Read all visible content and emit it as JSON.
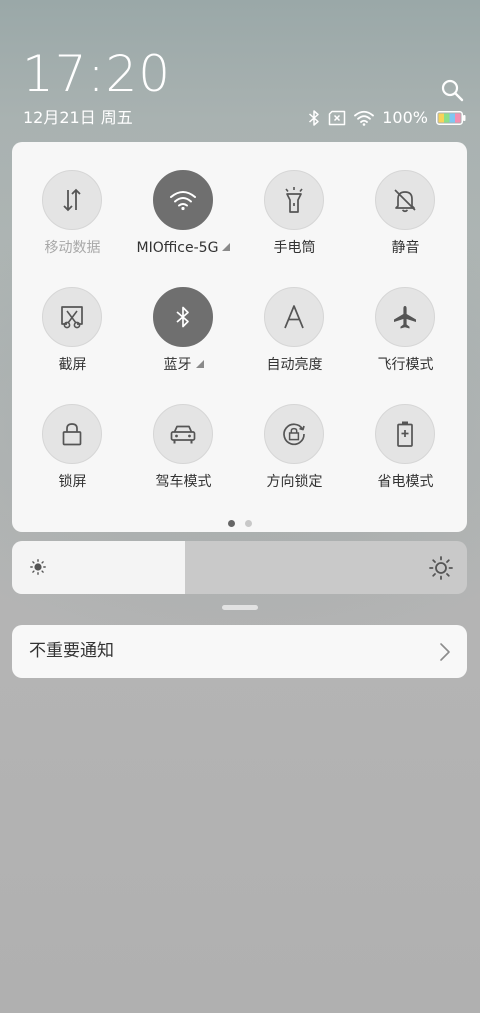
{
  "status": {
    "time": "17:20",
    "date": "12月21日 周五",
    "battery_percent": "100%"
  },
  "quick_settings": {
    "tiles": [
      {
        "label": "移动数据",
        "icon": "mobile-data-icon",
        "active": false,
        "disabled": true
      },
      {
        "label": "MIOffice-5G",
        "icon": "wifi-icon",
        "active": true,
        "disabled": false,
        "expandable": true
      },
      {
        "label": "手电筒",
        "icon": "flashlight-icon",
        "active": false,
        "disabled": false
      },
      {
        "label": "静音",
        "icon": "bell-off-icon",
        "active": false,
        "disabled": false
      },
      {
        "label": "截屏",
        "icon": "screenshot-icon",
        "active": false,
        "disabled": false
      },
      {
        "label": "蓝牙",
        "icon": "bluetooth-icon",
        "active": true,
        "disabled": false,
        "expandable": true
      },
      {
        "label": "自动亮度",
        "icon": "auto-brightness-icon",
        "active": false,
        "disabled": false
      },
      {
        "label": "飞行模式",
        "icon": "airplane-icon",
        "active": false,
        "disabled": false
      },
      {
        "label": "锁屏",
        "icon": "lock-icon",
        "active": false,
        "disabled": false
      },
      {
        "label": "驾车模式",
        "icon": "car-icon",
        "active": false,
        "disabled": false
      },
      {
        "label": "方向锁定",
        "icon": "rotation-lock-icon",
        "active": false,
        "disabled": false
      },
      {
        "label": "省电模式",
        "icon": "battery-saver-icon",
        "active": false,
        "disabled": false
      }
    ],
    "page_count": 2,
    "current_page": 1
  },
  "brightness": {
    "level_fraction": 0.38
  },
  "notification": {
    "label": "不重要通知"
  },
  "colors": {
    "active_tile": "#6f6f6f",
    "inactive_tile": "#e4e4e4",
    "card_background": "#fafafa"
  }
}
